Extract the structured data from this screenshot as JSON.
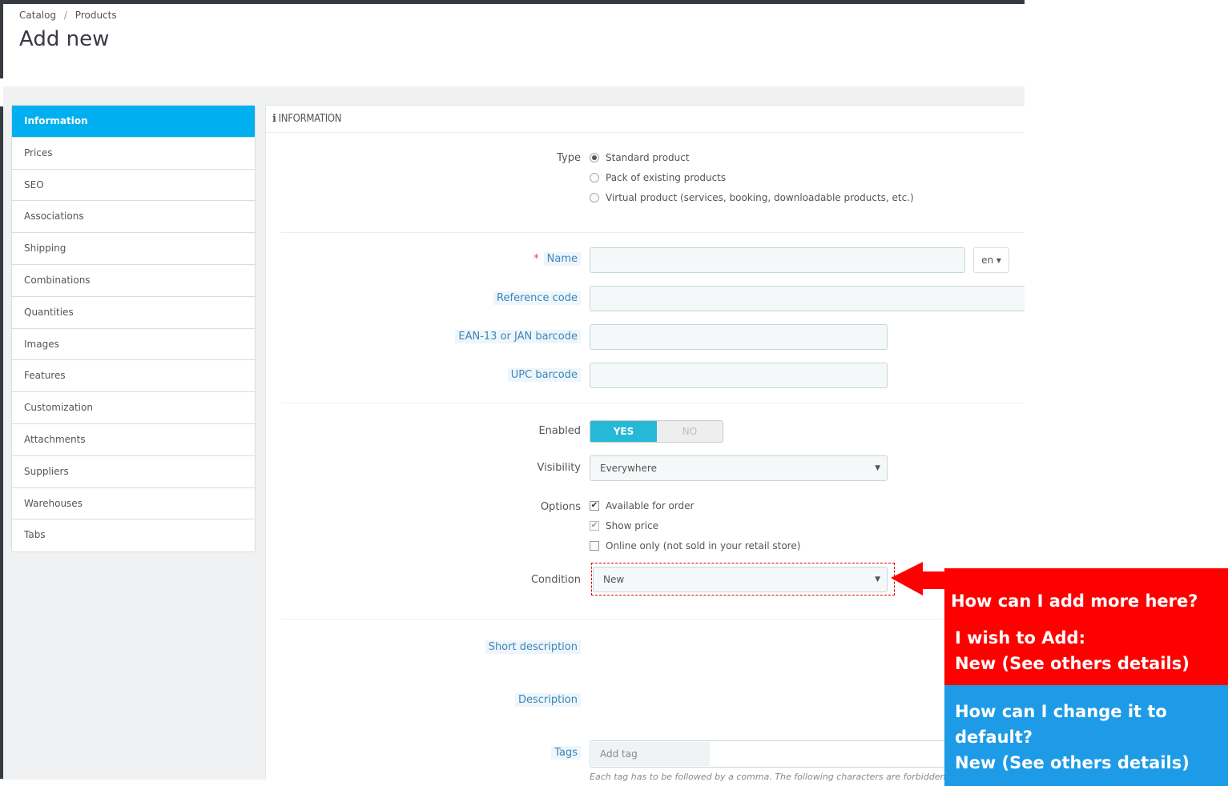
{
  "breadcrumb": {
    "root": "Catalog",
    "separator": "/",
    "current": "Products"
  },
  "page_title": "Add new",
  "sidebar": {
    "items": [
      {
        "label": "Information",
        "active": true
      },
      {
        "label": "Prices"
      },
      {
        "label": "SEO"
      },
      {
        "label": "Associations"
      },
      {
        "label": "Shipping"
      },
      {
        "label": "Combinations"
      },
      {
        "label": "Quantities"
      },
      {
        "label": "Images"
      },
      {
        "label": "Features"
      },
      {
        "label": "Customization"
      },
      {
        "label": "Attachments"
      },
      {
        "label": "Suppliers"
      },
      {
        "label": "Warehouses"
      },
      {
        "label": "Tabs"
      }
    ]
  },
  "panel": {
    "icon": "info-icon",
    "icon_glyph": "i",
    "title": "INFORMATION"
  },
  "form": {
    "type": {
      "label": "Type",
      "options": [
        "Standard product",
        "Pack of existing products",
        "Virtual product (services, booking, downloadable products, etc.)"
      ],
      "selected": "Standard product"
    },
    "name": {
      "required_mark": "*",
      "label": "Name",
      "value": "",
      "lang": "en"
    },
    "reference": {
      "label": "Reference code",
      "value": ""
    },
    "ean": {
      "label": "EAN-13 or JAN barcode",
      "value": ""
    },
    "upc": {
      "label": "UPC barcode",
      "value": ""
    },
    "enabled": {
      "label": "Enabled",
      "yes": "YES",
      "no": "NO",
      "value": "YES"
    },
    "visibility": {
      "label": "Visibility",
      "value": "Everywhere"
    },
    "options": {
      "label": "Options",
      "items": [
        {
          "label": "Available for order",
          "checked": true
        },
        {
          "label": "Show price",
          "checked": true,
          "disabled": true
        },
        {
          "label": "Online only (not sold in your retail store)",
          "checked": false
        }
      ]
    },
    "condition": {
      "label": "Condition",
      "value": "New"
    },
    "short_description": {
      "label": "Short description"
    },
    "description": {
      "label": "Description"
    },
    "tags": {
      "label": "Tags",
      "placeholder": "Add tag",
      "help": "Each tag has to be followed by a comma. The following characters are forbidden"
    }
  },
  "annotation": {
    "red_line1": "How can I add more here?",
    "red_line2": "I wish to Add:",
    "red_line3": "New (See others details)",
    "blue_line1": "How can I change it to",
    "blue_line2": "default?",
    "blue_line3": "New (See others details)",
    "colors": {
      "red": "#ff0000",
      "blue": "#1e9be6",
      "accent": "#00aff0",
      "toggle": "#25b9d7"
    }
  }
}
